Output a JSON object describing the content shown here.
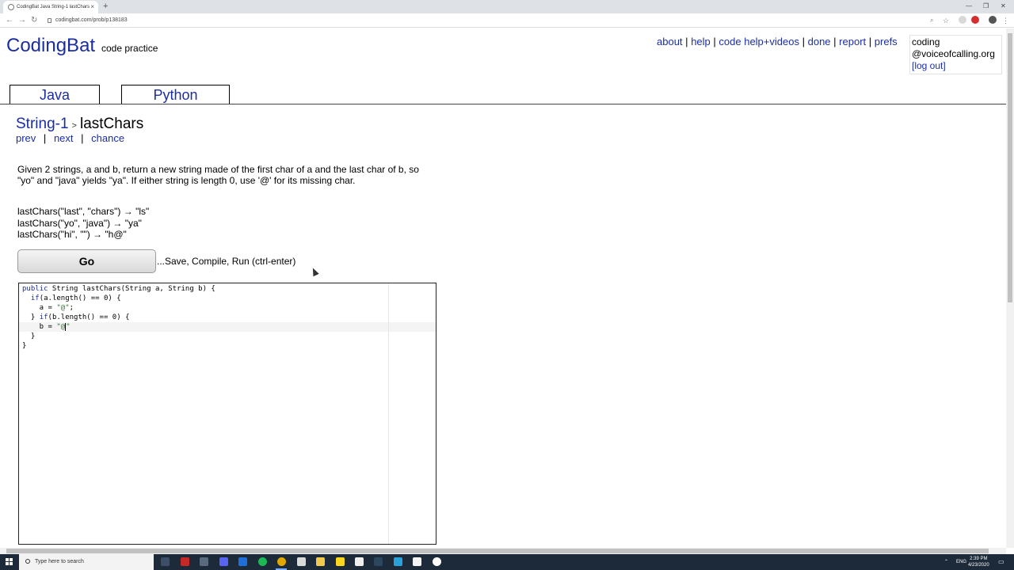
{
  "browser": {
    "tab_title": "CodingBat Java String-1 lastChars",
    "tab_close": "×",
    "new_tab": "+",
    "url": "codingbat.com/prob/p138183",
    "window_controls": [
      "—",
      "❐",
      "✕"
    ]
  },
  "site": {
    "logo": "CodingBat",
    "tagline": "code practice",
    "nav": [
      "about",
      "help",
      "code help+videos",
      "done",
      "report",
      "prefs"
    ],
    "nav_separator": "|",
    "user_line1": "coding",
    "user_line2": "@voiceofcalling.org",
    "logout": "[log out]"
  },
  "lang_tabs": [
    "Java",
    "Python"
  ],
  "problem": {
    "section": "String-1",
    "crumb_arrow": ">",
    "name": "lastChars",
    "nav": [
      "prev",
      "next",
      "chance"
    ],
    "nav_separator": "|",
    "description": "Given 2 strings, a and b, return a new string made of the first char of a and the last char of b, so \"yo\" and \"java\" yields \"ya\". If either string is length 0, use '@' for its missing char.",
    "examples": [
      "lastChars(\"last\", \"chars\") → \"ls\"",
      "lastChars(\"yo\", \"java\") → \"ya\"",
      "lastChars(\"hi\", \"\") → \"h@\""
    ]
  },
  "editor": {
    "go_label": "Go",
    "go_hint": "...Save, Compile, Run (ctrl-enter)",
    "code": {
      "l1_kw1": "public",
      "l1_rest": " String lastChars(String a, String b) {",
      "l2_kw": "if",
      "l2_rest": "(a.length() == 0) {",
      "l3_pre": "    a = ",
      "l3_str": "\"@\"",
      "l3_post": ";",
      "l4_pre": "  } ",
      "l4_kw": "if",
      "l4_rest": "(b.length() == 0) {",
      "l5_pre": "    b = ",
      "l5_str": "\"@",
      "l5_post": "\"",
      "l6": "  }",
      "l7": "}"
    }
  },
  "taskbar": {
    "search_placeholder": "Type here to search",
    "lang": "ENG",
    "time": "2:39 PM",
    "date": "4/23/2020"
  }
}
